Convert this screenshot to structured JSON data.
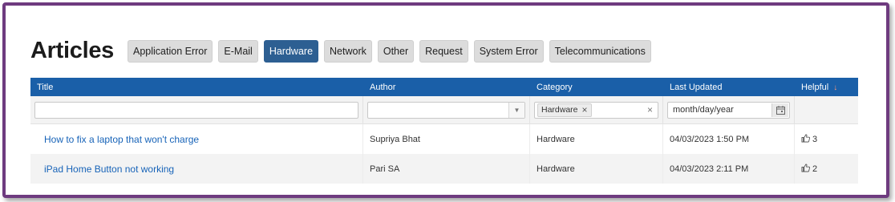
{
  "page": {
    "title": "Articles"
  },
  "categories": [
    {
      "label": "Application Error",
      "active": false
    },
    {
      "label": "E-Mail",
      "active": false
    },
    {
      "label": "Hardware",
      "active": true
    },
    {
      "label": "Network",
      "active": false
    },
    {
      "label": "Other",
      "active": false
    },
    {
      "label": "Request",
      "active": false
    },
    {
      "label": "System Error",
      "active": false
    },
    {
      "label": "Telecommunications",
      "active": false
    }
  ],
  "table": {
    "headers": {
      "title": "Title",
      "author": "Author",
      "category": "Category",
      "last_updated": "Last Updated",
      "helpful": "Helpful"
    },
    "sort": {
      "column": "helpful",
      "direction": "desc"
    },
    "filters": {
      "title_value": "",
      "author_value": "",
      "category_tag": "Hardware",
      "date_placeholder": "month/day/year"
    },
    "rows": [
      {
        "title": "How to fix a laptop that won't charge",
        "author": "Supriya Bhat",
        "category": "Hardware",
        "last_updated": "04/03/2023 1:50 PM",
        "helpful": "3"
      },
      {
        "title": "iPad Home Button not working",
        "author": "Pari SA",
        "category": "Hardware",
        "last_updated": "04/03/2023 2:11 PM",
        "helpful": "2"
      }
    ]
  },
  "colors": {
    "frame": "#6e3b7f",
    "header_bg": "#1a5fa8",
    "active_chip": "#2d5f92",
    "link": "#1763b8"
  },
  "icons": {
    "sort": "arrow-down-icon",
    "calendar": "calendar-icon",
    "thumbs_up": "thumbs-up-icon",
    "clear": "close-icon",
    "dropdown": "chevron-down-icon"
  }
}
